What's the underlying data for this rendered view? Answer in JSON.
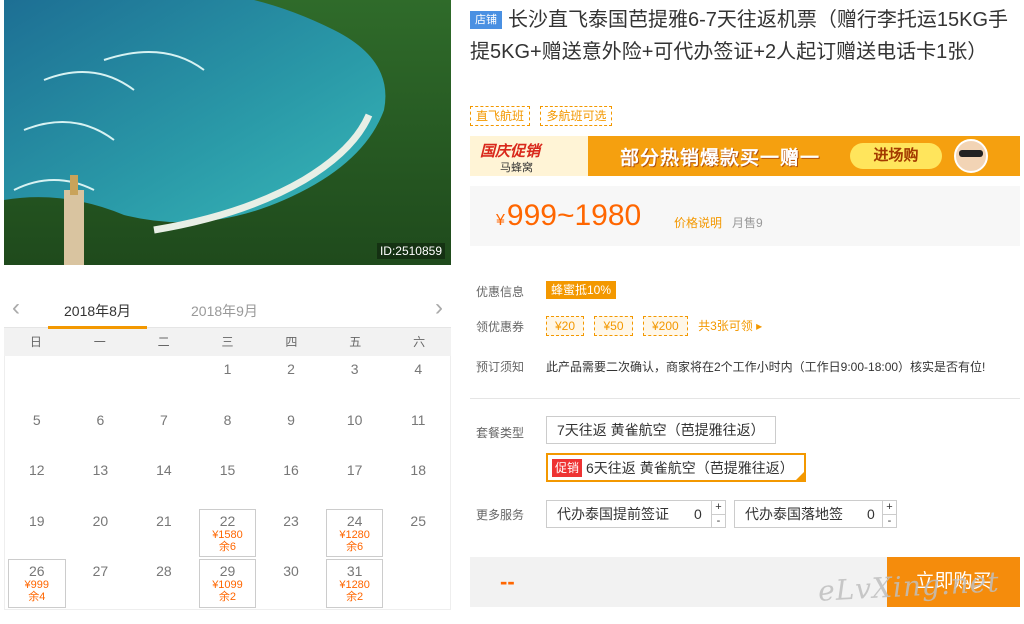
{
  "photo": {
    "id_label": "ID:2510859"
  },
  "calendar": {
    "prev_icon": "chevron-left-icon",
    "next_icon": "chevron-right-icon",
    "months": [
      "2018年8月",
      "2018年9月"
    ],
    "weekdays": [
      "日",
      "一",
      "二",
      "三",
      "四",
      "五",
      "六"
    ],
    "days": [
      {
        "day": "",
        "price": "",
        "remain": ""
      },
      {
        "day": "",
        "price": "",
        "remain": ""
      },
      {
        "day": "",
        "price": "",
        "remain": ""
      },
      {
        "day": "1",
        "price": "",
        "remain": ""
      },
      {
        "day": "2",
        "price": "",
        "remain": ""
      },
      {
        "day": "3",
        "price": "",
        "remain": ""
      },
      {
        "day": "4",
        "price": "",
        "remain": ""
      },
      {
        "day": "5",
        "price": "",
        "remain": ""
      },
      {
        "day": "6",
        "price": "",
        "remain": ""
      },
      {
        "day": "7",
        "price": "",
        "remain": ""
      },
      {
        "day": "8",
        "price": "",
        "remain": ""
      },
      {
        "day": "9",
        "price": "",
        "remain": ""
      },
      {
        "day": "10",
        "price": "",
        "remain": ""
      },
      {
        "day": "11",
        "price": "",
        "remain": ""
      },
      {
        "day": "12",
        "price": "",
        "remain": ""
      },
      {
        "day": "13",
        "price": "",
        "remain": ""
      },
      {
        "day": "14",
        "price": "",
        "remain": ""
      },
      {
        "day": "15",
        "price": "",
        "remain": ""
      },
      {
        "day": "16",
        "price": "",
        "remain": ""
      },
      {
        "day": "17",
        "price": "",
        "remain": ""
      },
      {
        "day": "18",
        "price": "",
        "remain": ""
      },
      {
        "day": "19",
        "price": "",
        "remain": ""
      },
      {
        "day": "20",
        "price": "",
        "remain": ""
      },
      {
        "day": "21",
        "price": "",
        "remain": ""
      },
      {
        "day": "22",
        "price": "¥1580",
        "remain": "余6"
      },
      {
        "day": "23",
        "price": "",
        "remain": ""
      },
      {
        "day": "24",
        "price": "¥1280",
        "remain": "余6"
      },
      {
        "day": "25",
        "price": "",
        "remain": ""
      },
      {
        "day": "26",
        "price": "¥999",
        "remain": "余4"
      },
      {
        "day": "27",
        "price": "",
        "remain": ""
      },
      {
        "day": "28",
        "price": "",
        "remain": ""
      },
      {
        "day": "29",
        "price": "¥1099",
        "remain": "余2"
      },
      {
        "day": "30",
        "price": "",
        "remain": ""
      },
      {
        "day": "31",
        "price": "¥1280",
        "remain": "余2"
      },
      {
        "day": "",
        "price": "",
        "remain": ""
      }
    ]
  },
  "product": {
    "shop_tag": "店铺",
    "title": "长沙直飞泰国芭提雅6-7天往返机票（赠行李托运15KG手提5KG+赠送意外险+可代办签证+2人起订赠送电话卡1张）",
    "tags": [
      "直飞航班",
      "多航班可选"
    ],
    "banner": {
      "brand": "国庆促销",
      "sub": "马蜂窝",
      "main": "部分热销爆款买一赠一",
      "button": "进场购"
    },
    "price": {
      "currency": "¥",
      "range": "999~1980",
      "explain": "价格说明",
      "monthly_sales": "月售9"
    }
  },
  "info": {
    "discount_label": "优惠信息",
    "discount_badge": "蜂蜜抵10%",
    "coupon_label": "领优惠券",
    "coupons": [
      "¥20",
      "¥50",
      "¥200"
    ],
    "coupon_more": "共3张可领 ▸",
    "notice_label": "预订须知",
    "notice_text": "此产品需要二次确认，商家将在2个工作小时内（工作日9:00-18:00）核实是否有位!"
  },
  "package": {
    "label": "套餐类型",
    "options": [
      "7天往返 黄雀航空（芭提雅往返）",
      "6天往返 黄雀航空（芭提雅往返）"
    ],
    "promo_tag": "促销"
  },
  "services": {
    "label": "更多服务",
    "items": [
      {
        "name": "代办泰国提前签证",
        "qty": "0"
      },
      {
        "name": "代办泰国落地签",
        "qty": "0"
      }
    ],
    "plus": "+",
    "minus": "-"
  },
  "buy": {
    "total": "--",
    "button": "立即购买"
  },
  "watermark": "eLvXing.net"
}
